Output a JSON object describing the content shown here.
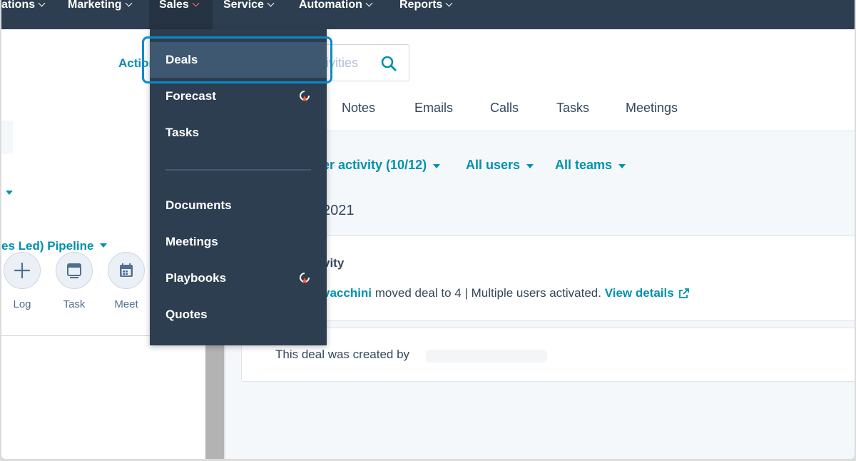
{
  "topnav": {
    "items": [
      {
        "label": "ations",
        "active": false
      },
      {
        "label": "Marketing",
        "active": false
      },
      {
        "label": "Sales",
        "active": true
      },
      {
        "label": "Service",
        "active": false
      },
      {
        "label": "Automation",
        "active": false
      },
      {
        "label": "Reports",
        "active": false
      }
    ]
  },
  "left": {
    "actions_label": "Actions",
    "pipeline_label": "es Led) Pipeline",
    "activity_buttons": [
      {
        "label": "Log",
        "icon": "plus-icon"
      },
      {
        "label": "Task",
        "icon": "task-icon"
      },
      {
        "label": "Meet",
        "icon": "calendar-icon"
      }
    ]
  },
  "main": {
    "search_placeholder": "Search activities",
    "search_visible": "ivities",
    "tabs": [
      "Notes",
      "Emails",
      "Calls",
      "Tasks",
      "Meetings"
    ],
    "filters": [
      {
        "label": "er activity (10/12)"
      },
      {
        "label": "All users"
      },
      {
        "label": "All teams"
      }
    ],
    "date_heading": "2021",
    "card1": {
      "title": "vity",
      "actor": "vacchini",
      "text": " moved deal to 4 | Multiple users activated. ",
      "link": "View details"
    },
    "card2": {
      "text": "This deal was created by"
    }
  },
  "dropdown": {
    "items": [
      {
        "label": "Deals",
        "badge": false
      },
      {
        "label": "Forecast",
        "badge": true
      },
      {
        "label": "Tasks",
        "badge": false
      },
      {
        "label": "Documents",
        "badge": false
      },
      {
        "label": "Meetings",
        "badge": false
      },
      {
        "label": "Playbooks",
        "badge": true
      },
      {
        "label": "Quotes",
        "badge": false
      }
    ]
  },
  "colors": {
    "nav_bg": "#2d3e50",
    "accent_link": "#0091ae",
    "focus_ring": "#0b8ac9",
    "badge_star": "#ff5c35"
  }
}
